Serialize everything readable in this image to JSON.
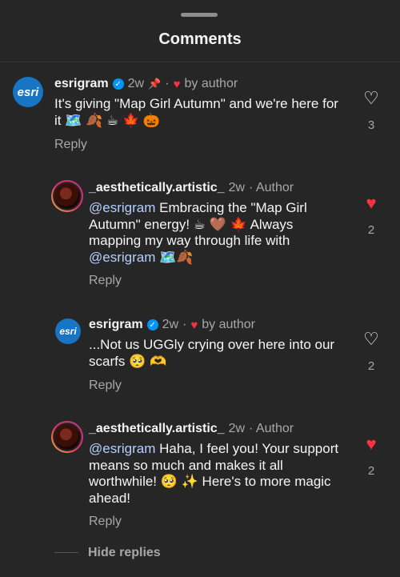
{
  "header": {
    "title": "Comments"
  },
  "comments": [
    {
      "username": "esrigram",
      "verified": true,
      "pinned": true,
      "time": "2w",
      "liked_by_author": "by author",
      "text_before": "It's giving \"Map Girl Autumn\" and we're here for it 🗺️ 🍂 ☕ 🍁 🎃",
      "likes": "3",
      "liked": false,
      "reply_label": "Reply",
      "avatar_label": "esri"
    },
    {
      "username": "_aesthetically.artistic_",
      "time": "2w",
      "author_tag": "· Author",
      "mention": "@esrigram",
      "text": " Embracing the \"Map Girl Autumn\" energy! ☕ 🤎 🍁  Always mapping my way through life with ",
      "mention2": "@esrigram",
      "text_after": " 🗺️🍂",
      "likes": "2",
      "liked": true,
      "reply_label": "Reply"
    },
    {
      "username": "esrigram",
      "verified": true,
      "time": "2w",
      "liked_by_author": "by author",
      "text": "...Not us UGGly crying over here into our scarfs 🥺  🫶",
      "likes": "2",
      "liked": false,
      "reply_label": "Reply",
      "avatar_label": "esri"
    },
    {
      "username": "_aesthetically.artistic_",
      "time": "2w",
      "author_tag": "· Author",
      "mention": "@esrigram",
      "text": " Haha, I feel you! Your support means so much and makes it all worthwhile! 🥺 ✨  Here's to more magic ahead!",
      "likes": "2",
      "liked": true,
      "reply_label": "Reply"
    }
  ],
  "footer": {
    "hide_replies": "Hide replies"
  },
  "icons": {
    "heart": "heart-icon",
    "verified": "verified-badge-icon",
    "pin": "pin-icon"
  },
  "colors": {
    "background": "#262626",
    "like_red": "#ff3040",
    "mention_blue": "#b5d0ff",
    "verified_blue": "#0095f6"
  }
}
